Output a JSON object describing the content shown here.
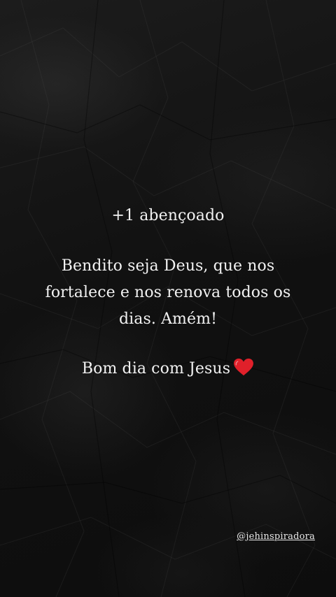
{
  "background": {
    "texture": "crumpled-black-paper",
    "base_color": "#121212"
  },
  "post": {
    "line1": "+1 abençoado",
    "paragraph_lines": [
      "Bendito seja Deus, que nos",
      "fortalece e nos renova todos os",
      "dias. Amém!"
    ],
    "closing": "Bom dia com Jesus",
    "heart_icon": "red-heart-icon",
    "heart_color": "#e0202a",
    "text_color": "#f2f2f2"
  },
  "handle": "@jehinspiradora"
}
